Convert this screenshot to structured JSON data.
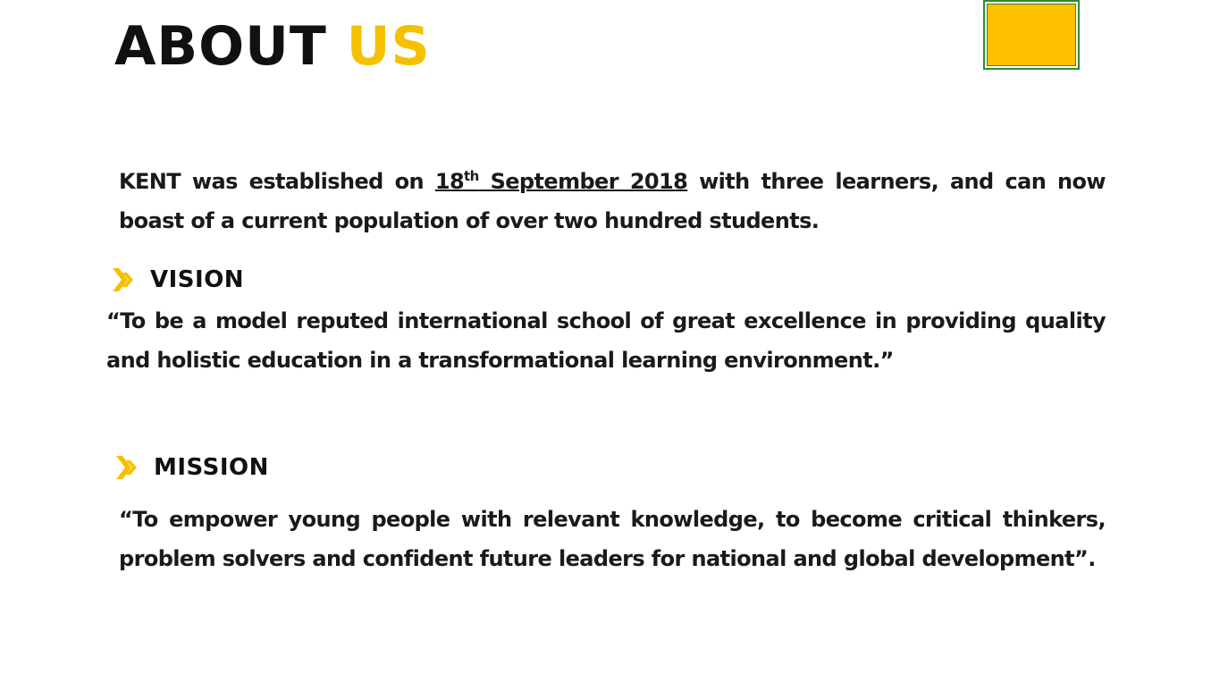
{
  "title": {
    "word1": "ABOUT",
    "word2": "US"
  },
  "colors": {
    "accent_yellow": "#f5c000",
    "box_fill": "#ffc000",
    "box_border": "#2e8b2e",
    "text": "#111111"
  },
  "intro": {
    "before": "KENT was established on ",
    "date_day": "18",
    "date_suffix": "th",
    "date_rest": " September 2018",
    "after": " with three learners, and can now boast of a current population of over two hundred students."
  },
  "vision": {
    "heading": "VISION",
    "icon": "double-chevron-right-icon",
    "text": "“To be a model reputed international school of great excellence in providing quality and holistic education in a transformational learning environment.”"
  },
  "mission": {
    "heading": "MISSION",
    "icon": "double-chevron-right-icon",
    "text": "“To empower young people with relevant knowledge, to become critical thinkers, problem solvers and confident future leaders for national and global development”."
  }
}
